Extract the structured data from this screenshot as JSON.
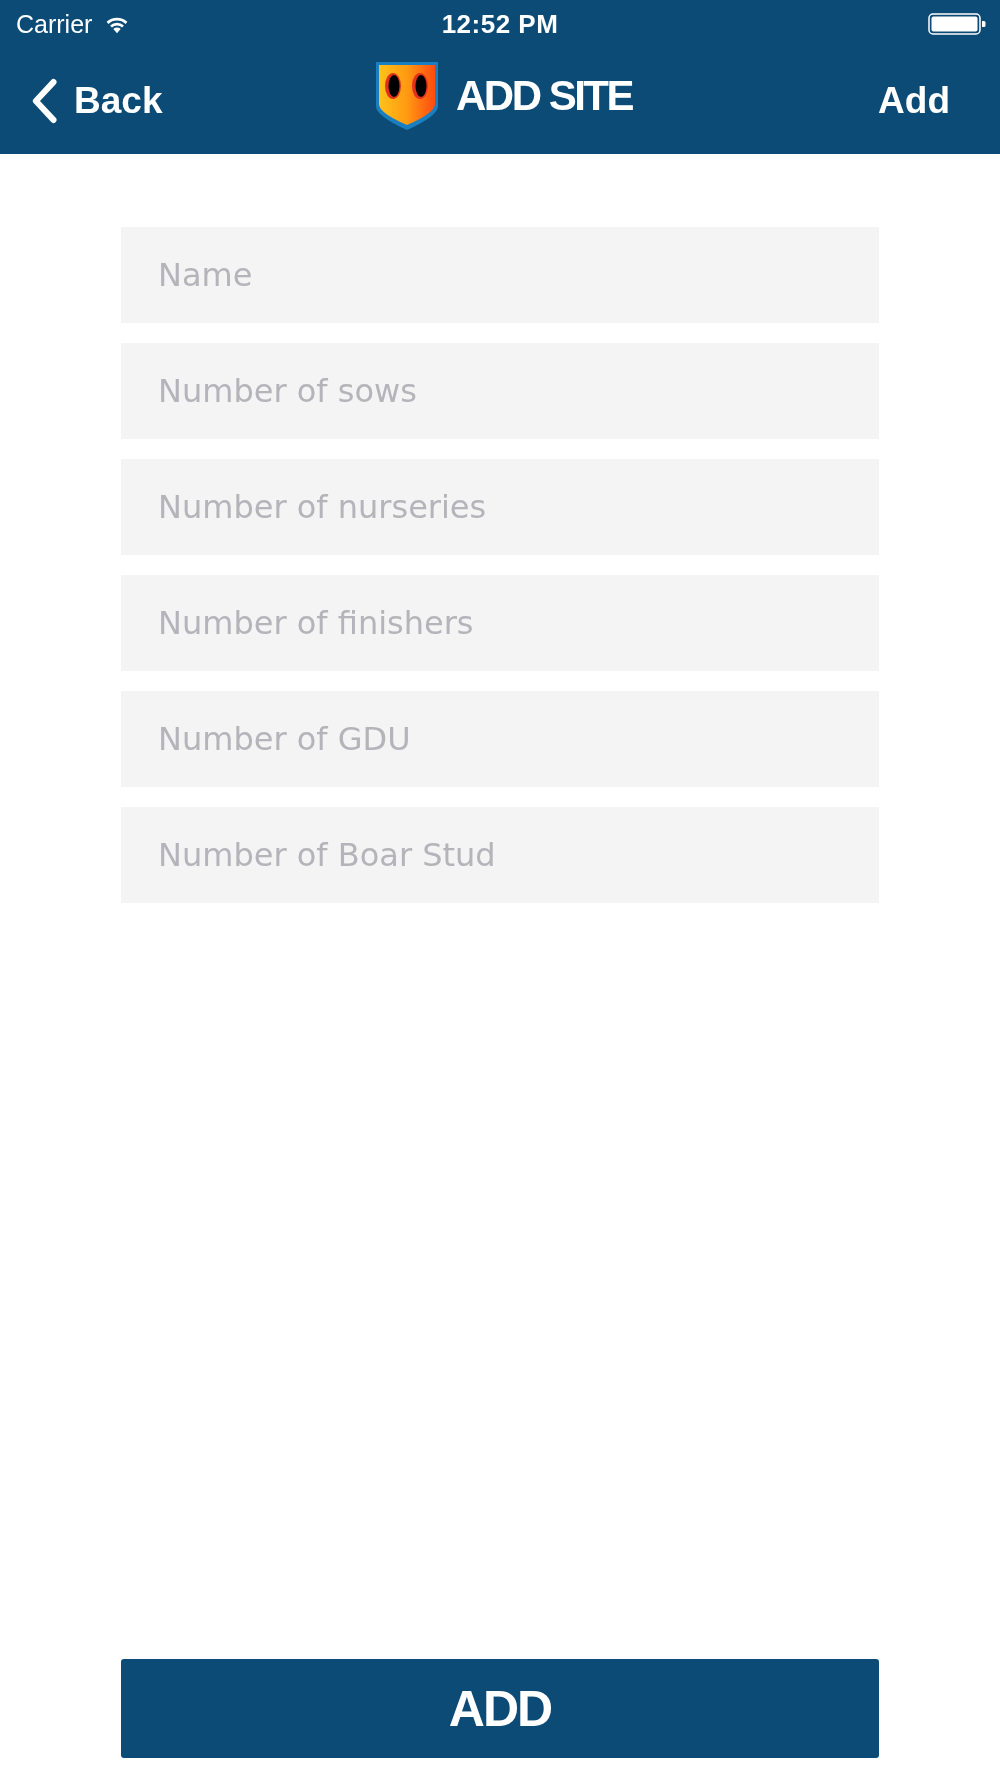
{
  "status_bar": {
    "carrier": "Carrier",
    "time": "12:52 PM"
  },
  "nav_bar": {
    "back": "Back",
    "title": "ADD SITE",
    "action": "Add"
  },
  "form": {
    "fields": [
      {
        "placeholder": "Name"
      },
      {
        "placeholder": "Number of sows"
      },
      {
        "placeholder": "Number of nurseries"
      },
      {
        "placeholder": "Number of finishers"
      },
      {
        "placeholder": "Number of GDU"
      },
      {
        "placeholder": "Number of Boar Stud"
      }
    ]
  },
  "submit_button": {
    "label": "ADD"
  }
}
